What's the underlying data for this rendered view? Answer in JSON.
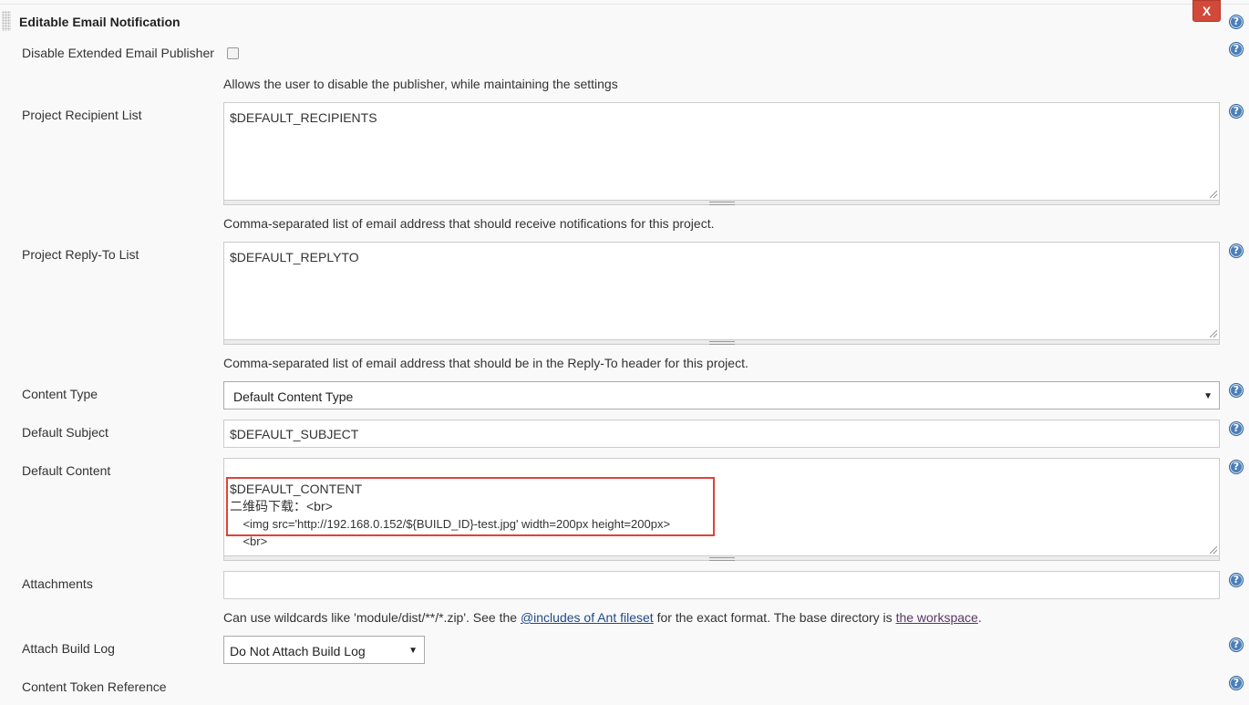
{
  "section": {
    "title": "Editable Email Notification",
    "close_label": "X"
  },
  "help_icon_glyph": "?",
  "fields": {
    "disable_publisher": {
      "label": "Disable Extended Email Publisher",
      "checked": false,
      "description": "Allows the user to disable the publisher, while maintaining the settings"
    },
    "recipient_list": {
      "label": "Project Recipient List",
      "value": "$DEFAULT_RECIPIENTS",
      "description": "Comma-separated list of email address that should receive notifications for this project."
    },
    "reply_to_list": {
      "label": "Project Reply-To List",
      "value": "$DEFAULT_REPLYTO",
      "description": "Comma-separated list of email address that should be in the Reply-To header for this project."
    },
    "content_type": {
      "label": "Content Type",
      "selected": "Default Content Type"
    },
    "default_subject": {
      "label": "Default Subject",
      "value": "$DEFAULT_SUBJECT"
    },
    "default_content": {
      "label": "Default Content",
      "lines": [
        "$DEFAULT_CONTENT",
        "二维码下载：<br>",
        "    <img src='http://192.168.0.152/${BUILD_ID}-test.jpg' width=200px height=200px>",
        "    <br>"
      ]
    },
    "attachments": {
      "label": "Attachments",
      "value": "",
      "description_prefix": "Can use wildcards like 'module/dist/**/*.zip'. See the ",
      "link1": "@includes of Ant fileset",
      "description_middle": " for the exact format. The base directory is ",
      "link2": "the workspace",
      "description_suffix": "."
    },
    "attach_build_log": {
      "label": "Attach Build Log",
      "selected": "Do Not Attach Build Log"
    },
    "content_token_reference": {
      "label": "Content Token Reference"
    }
  },
  "colors": {
    "close_button": "#d24939",
    "highlight_box": "#e0423a",
    "help_icon": "#4a7fb8",
    "link": "#204a87"
  }
}
